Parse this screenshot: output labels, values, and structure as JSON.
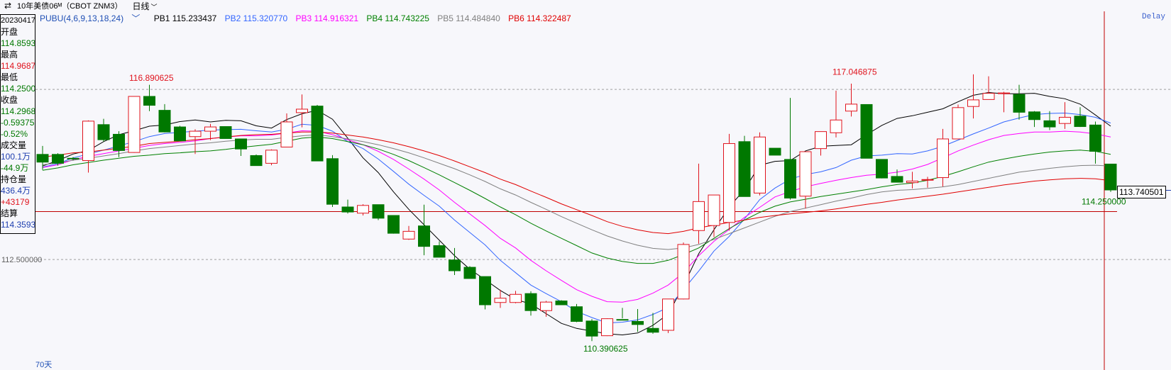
{
  "header": {
    "title": "10年美债06ᴹ（CBOT ZNM3）",
    "period": "日线",
    "delay": "Delay"
  },
  "legend": {
    "indicator": "PUBU(4,6,9,13,18,24)",
    "pb1": "PB1 115.233437",
    "pb2": "PB2 115.320770",
    "pb3": "PB3 114.916321",
    "pb4": "PB4 114.743225",
    "pb5": "PB5 114.484840",
    "pb6": "PB6 114.322487"
  },
  "info": {
    "date": "20230417",
    "open_label": "开盘",
    "open": "114.8593",
    "high_label": "最高",
    "high": "114.9687",
    "low_label": "最低",
    "low": "114.2500",
    "close_label": "收盘",
    "close": "114.2968",
    "change": "-0.59375",
    "change_pct": "-0.52%",
    "volume_label": "成交量",
    "volume": "100.1万",
    "volume_change": "-44.9万",
    "oi_label": "持仓量",
    "oi": "436.4万",
    "oi_change": "+43179",
    "settle_label": "结算",
    "settle": "114.3593"
  },
  "footer": {
    "days": "70天"
  },
  "colors": {
    "up": "#e0141e",
    "down": "#007800",
    "pb1": "#000000",
    "pb2": "#3366ff",
    "pb3": "#ff00ff",
    "pb4": "#008000",
    "pb5": "#808080",
    "pb6": "#e00000"
  },
  "chart_data": {
    "type": "candlestick",
    "ylim": [
      109.9,
      118.7
    ],
    "ytick_label": "112.500000",
    "reference_price": "113.740501",
    "annotations": {
      "high_1": "116.890625",
      "high_2": "117.046875",
      "low": "110.390625",
      "last_low": "114.250000"
    },
    "candles": [
      {
        "o": 115.22,
        "h": 115.44,
        "l": 114.82,
        "c": 115.02
      },
      {
        "o": 115.22,
        "h": 115.25,
        "l": 114.93,
        "c": 114.99
      },
      {
        "o": 115.12,
        "h": 115.15,
        "l": 115.06,
        "c": 115.11
      },
      {
        "o": 115.06,
        "h": 116.1,
        "l": 114.75,
        "c": 116.08
      },
      {
        "o": 115.99,
        "h": 116.14,
        "l": 115.55,
        "c": 115.6
      },
      {
        "o": 115.74,
        "h": 115.82,
        "l": 115.15,
        "c": 115.32
      },
      {
        "o": 115.27,
        "h": 116.73,
        "l": 115.26,
        "c": 116.72
      },
      {
        "o": 116.72,
        "h": 117.02,
        "l": 116.34,
        "c": 116.49
      },
      {
        "o": 116.36,
        "h": 116.52,
        "l": 115.79,
        "c": 115.8
      },
      {
        "o": 115.93,
        "h": 115.96,
        "l": 115.59,
        "c": 115.57
      },
      {
        "o": 115.68,
        "h": 115.87,
        "l": 115.23,
        "c": 115.82
      },
      {
        "o": 115.82,
        "h": 116.01,
        "l": 115.59,
        "c": 115.93
      },
      {
        "o": 115.94,
        "h": 115.94,
        "l": 115.64,
        "c": 115.63
      },
      {
        "o": 115.62,
        "h": 115.52,
        "l": 115.18,
        "c": 115.36
      },
      {
        "o": 115.19,
        "h": 115.22,
        "l": 115.12,
        "c": 114.93
      },
      {
        "o": 114.99,
        "h": 115.35,
        "l": 114.94,
        "c": 115.33
      },
      {
        "o": 115.41,
        "h": 116.28,
        "l": 115.44,
        "c": 116.06
      },
      {
        "o": 116.3,
        "h": 116.77,
        "l": 115.92,
        "c": 116.39
      },
      {
        "o": 116.47,
        "h": 116.5,
        "l": 115.41,
        "c": 115.05
      },
      {
        "o": 115.11,
        "h": 115.2,
        "l": 113.86,
        "c": 113.93
      },
      {
        "o": 113.86,
        "h": 114.05,
        "l": 113.69,
        "c": 113.73
      },
      {
        "o": 113.7,
        "h": 113.93,
        "l": 113.64,
        "c": 113.9
      },
      {
        "o": 113.92,
        "h": 113.89,
        "l": 113.52,
        "c": 113.57
      },
      {
        "o": 113.64,
        "h": 113.39,
        "l": 113.17,
        "c": 113.18
      },
      {
        "o": 113.03,
        "h": 113.37,
        "l": 113.01,
        "c": 113.23
      },
      {
        "o": 113.37,
        "h": 113.92,
        "l": 112.61,
        "c": 112.84
      },
      {
        "o": 112.86,
        "h": 112.97,
        "l": 112.56,
        "c": 112.56
      },
      {
        "o": 112.49,
        "h": 112.8,
        "l": 112.1,
        "c": 112.21
      },
      {
        "o": 112.3,
        "h": 112.33,
        "l": 112.08,
        "c": 112.01
      },
      {
        "o": 112.06,
        "h": 112.04,
        "l": 111.21,
        "c": 111.33
      },
      {
        "o": 111.39,
        "h": 111.72,
        "l": 111.25,
        "c": 111.5
      },
      {
        "o": 111.39,
        "h": 111.69,
        "l": 111.37,
        "c": 111.6
      },
      {
        "o": 111.62,
        "h": 111.68,
        "l": 111.05,
        "c": 111.18
      },
      {
        "o": 111.18,
        "h": 111.43,
        "l": 111.02,
        "c": 111.4
      },
      {
        "o": 111.43,
        "h": 111.45,
        "l": 111.32,
        "c": 111.33
      },
      {
        "o": 111.28,
        "h": 111.35,
        "l": 110.88,
        "c": 110.9
      },
      {
        "o": 110.91,
        "h": 110.96,
        "l": 110.39,
        "c": 110.52
      },
      {
        "o": 110.53,
        "h": 110.98,
        "l": 110.52,
        "c": 110.97
      },
      {
        "o": 110.95,
        "h": 111.25,
        "l": 110.98,
        "c": 110.94
      },
      {
        "o": 110.9,
        "h": 111.22,
        "l": 110.63,
        "c": 110.82
      },
      {
        "o": 110.72,
        "h": 111.12,
        "l": 110.58,
        "c": 110.62
      },
      {
        "o": 110.67,
        "h": 111.46,
        "l": 110.6,
        "c": 111.48
      },
      {
        "o": 111.48,
        "h": 112.94,
        "l": 111.47,
        "c": 112.89
      },
      {
        "o": 113.25,
        "h": 114.98,
        "l": 112.91,
        "c": 114.0
      },
      {
        "o": 113.38,
        "h": 114.17,
        "l": 113.08,
        "c": 114.17
      },
      {
        "o": 113.46,
        "h": 115.75,
        "l": 113.25,
        "c": 115.5
      },
      {
        "o": 115.55,
        "h": 115.7,
        "l": 114.13,
        "c": 114.13
      },
      {
        "o": 114.22,
        "h": 115.79,
        "l": 114.16,
        "c": 115.67
      },
      {
        "o": 115.38,
        "h": 115.32,
        "l": 115.23,
        "c": 115.2
      },
      {
        "o": 115.09,
        "h": 116.68,
        "l": 114.05,
        "c": 114.09
      },
      {
        "o": 114.14,
        "h": 114.94,
        "l": 113.82,
        "c": 115.29
      },
      {
        "o": 115.37,
        "h": 115.81,
        "l": 115.19,
        "c": 115.81
      },
      {
        "o": 115.78,
        "h": 116.87,
        "l": 115.66,
        "c": 116.11
      },
      {
        "o": 116.34,
        "h": 117.05,
        "l": 116.2,
        "c": 116.52
      },
      {
        "o": 116.51,
        "h": 116.51,
        "l": 115.12,
        "c": 115.12
      },
      {
        "o": 115.09,
        "h": 115.05,
        "l": 114.6,
        "c": 114.61
      },
      {
        "o": 114.65,
        "h": 114.83,
        "l": 114.5,
        "c": 114.5
      },
      {
        "o": 114.49,
        "h": 114.77,
        "l": 114.34,
        "c": 114.53
      },
      {
        "o": 114.56,
        "h": 114.64,
        "l": 114.36,
        "c": 114.57
      },
      {
        "o": 114.62,
        "h": 115.88,
        "l": 114.39,
        "c": 115.62
      },
      {
        "o": 115.62,
        "h": 116.51,
        "l": 115.72,
        "c": 116.43
      },
      {
        "o": 116.46,
        "h": 117.29,
        "l": 116.15,
        "c": 116.63
      },
      {
        "o": 116.64,
        "h": 117.24,
        "l": 116.8,
        "c": 116.8
      },
      {
        "o": 116.79,
        "h": 116.84,
        "l": 116.31,
        "c": 116.81
      },
      {
        "o": 116.77,
        "h": 117.02,
        "l": 116.12,
        "c": 116.31
      },
      {
        "o": 116.32,
        "h": 116.34,
        "l": 115.93,
        "c": 116.12
      },
      {
        "o": 116.09,
        "h": 116.34,
        "l": 115.85,
        "c": 115.93
      },
      {
        "o": 116.02,
        "h": 116.57,
        "l": 115.88,
        "c": 116.18
      },
      {
        "o": 116.21,
        "h": 116.44,
        "l": 115.93,
        "c": 115.94
      },
      {
        "o": 115.98,
        "h": 116.07,
        "l": 114.98,
        "c": 115.3
      },
      {
        "o": 114.97,
        "h": 114.97,
        "l": 114.25,
        "c": 114.3
      }
    ],
    "pb_series": [
      {
        "name": "PB1",
        "values": [
          114.92,
          115.06,
          115.23,
          115.32,
          115.55,
          115.73,
          115.83,
          115.95,
          115.98,
          116.07,
          116.11,
          116.06,
          116.1,
          116.09,
          115.96,
          115.9,
          116.12,
          116.27,
          116.36,
          116.13,
          115.64,
          115.13,
          114.75,
          114.25,
          113.8,
          113.4,
          113.0,
          112.6,
          112.25,
          111.98,
          111.7,
          111.47,
          111.35,
          111.1,
          110.85,
          110.72,
          110.65,
          110.58,
          110.55,
          110.6,
          110.8,
          111.09,
          111.82,
          112.65,
          113.27,
          113.86,
          114.31,
          114.94,
          115.04,
          115.06,
          115.31,
          115.43,
          115.45,
          115.47,
          115.73,
          115.97,
          116.15,
          116.22,
          116.31,
          116.4,
          116.58,
          116.75,
          116.82,
          116.79,
          116.79,
          116.8,
          116.72,
          116.66,
          116.52,
          116.24,
          115.95
        ]
      },
      {
        "name": "PB2",
        "values": [
          114.89,
          114.98,
          115.13,
          115.23,
          115.33,
          115.44,
          115.55,
          115.68,
          115.76,
          115.79,
          115.82,
          115.85,
          115.86,
          115.87,
          115.83,
          115.8,
          115.87,
          116.0,
          115.97,
          115.82,
          115.55,
          115.37,
          115.1,
          114.78,
          114.45,
          114.16,
          113.88,
          113.52,
          113.2,
          112.88,
          112.48,
          112.16,
          111.84,
          111.62,
          111.41,
          111.16,
          111.0,
          110.86,
          110.88,
          110.94,
          111.08,
          111.26,
          111.72,
          112.2,
          112.72,
          113.1,
          113.55,
          114.05,
          114.35,
          114.58,
          114.7,
          114.77,
          114.88,
          115.07,
          115.18,
          115.2,
          115.24,
          115.23,
          115.31,
          115.43,
          115.59,
          115.75,
          115.9,
          116.06,
          116.16,
          116.25,
          116.28,
          116.29,
          116.25,
          116.18,
          116.03
        ]
      },
      {
        "name": "PB3",
        "values": [
          114.88,
          114.95,
          115.08,
          115.17,
          115.24,
          115.31,
          115.38,
          115.45,
          115.5,
          115.53,
          115.57,
          115.63,
          115.67,
          115.7,
          115.7,
          115.72,
          115.77,
          115.83,
          115.82,
          115.73,
          115.6,
          115.47,
          115.3,
          115.09,
          114.84,
          114.58,
          114.3,
          113.98,
          113.68,
          113.38,
          113.05,
          112.8,
          112.48,
          112.21,
          111.96,
          111.72,
          111.55,
          111.41,
          111.4,
          111.47,
          111.63,
          111.84,
          112.16,
          112.6,
          112.97,
          113.28,
          113.59,
          113.85,
          114.12,
          114.26,
          114.38,
          114.47,
          114.55,
          114.62,
          114.68,
          114.71,
          114.76,
          114.84,
          114.96,
          115.13,
          115.31,
          115.46,
          115.6,
          115.71,
          115.76,
          115.8,
          115.8,
          115.82,
          115.8,
          115.75,
          115.67
        ]
      },
      {
        "name": "PB4",
        "values": [
          114.81,
          114.87,
          114.95,
          115.01,
          115.07,
          115.12,
          115.17,
          115.2,
          115.24,
          115.26,
          115.29,
          115.31,
          115.35,
          115.4,
          115.44,
          115.48,
          115.56,
          115.64,
          115.67,
          115.63,
          115.55,
          115.47,
          115.36,
          115.22,
          115.06,
          114.88,
          114.69,
          114.49,
          114.29,
          114.08,
          113.86,
          113.66,
          113.44,
          113.24,
          113.05,
          112.86,
          112.67,
          112.54,
          112.45,
          112.4,
          112.4,
          112.48,
          112.63,
          112.8,
          113.05,
          113.3,
          113.52,
          113.72,
          113.88,
          113.99,
          114.06,
          114.13,
          114.19,
          114.25,
          114.31,
          114.38,
          114.44,
          114.48,
          114.55,
          114.65,
          114.77,
          114.9,
          115.02,
          115.1,
          115.17,
          115.23,
          115.28,
          115.31,
          115.33,
          115.3,
          115.22
        ]
      },
      {
        "name": "PB5",
        "values": [
          114.95,
          115.0,
          115.07,
          115.12,
          115.18,
          115.24,
          115.31,
          115.37,
          115.41,
          115.45,
          115.49,
          115.52,
          115.56,
          115.59,
          115.61,
          115.61,
          115.66,
          115.7,
          115.73,
          115.68,
          115.62,
          115.55,
          115.47,
          115.37,
          115.26,
          115.13,
          114.99,
          114.85,
          114.69,
          114.52,
          114.33,
          114.17,
          113.98,
          113.8,
          113.61,
          113.44,
          113.27,
          113.11,
          112.98,
          112.87,
          112.79,
          112.76,
          112.8,
          112.89,
          113.02,
          113.17,
          113.32,
          113.47,
          113.62,
          113.74,
          113.83,
          113.92,
          114.01,
          114.09,
          114.18,
          114.25,
          114.29,
          114.31,
          114.34,
          114.38,
          114.44,
          114.52,
          114.6,
          114.68,
          114.76,
          114.81,
          114.86,
          114.9,
          114.93,
          114.94,
          114.92
        ]
      },
      {
        "name": "PB6",
        "values": [
          115.15,
          115.2,
          115.26,
          115.28,
          115.33,
          115.38,
          115.43,
          115.5,
          115.53,
          115.56,
          115.6,
          115.63,
          115.67,
          115.71,
          115.73,
          115.74,
          115.77,
          115.8,
          115.8,
          115.77,
          115.72,
          115.67,
          115.6,
          115.52,
          115.42,
          115.31,
          115.19,
          115.05,
          114.9,
          114.75,
          114.58,
          114.44,
          114.27,
          114.11,
          113.94,
          113.79,
          113.64,
          113.48,
          113.36,
          113.27,
          113.2,
          113.17,
          113.23,
          113.32,
          113.39,
          113.46,
          113.52,
          113.59,
          113.64,
          113.68,
          113.72,
          113.76,
          113.81,
          113.87,
          113.93,
          113.98,
          114.04,
          114.09,
          114.14,
          114.19,
          114.25,
          114.31,
          114.37,
          114.43,
          114.48,
          114.53,
          114.56,
          114.59,
          114.6,
          114.59,
          114.54
        ]
      }
    ]
  }
}
